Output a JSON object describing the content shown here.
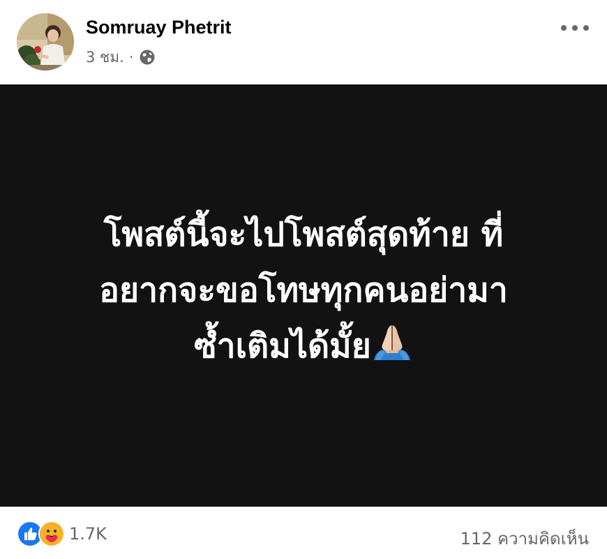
{
  "post": {
    "author_name": "Somruay Phetrit",
    "timestamp": "3 ชม.",
    "meta_separator": "·",
    "privacy_icon": "globe-icon",
    "more_icon": "more-options-icon",
    "image_text_lines": [
      "โพสต์นี้จะไปโพสต์สุดท้าย ที่",
      "อยากจะขอโทษทุกคนอย่ามา",
      "ซ้ำเติมได้มั้ย"
    ],
    "image_emoji": "folded-hands-icon",
    "image_background": "#121212"
  },
  "footer": {
    "reaction_icons": [
      "like-icon",
      "care-icon"
    ],
    "reaction_count": "1.7K",
    "comments": "112 ความคิดเห็น"
  },
  "colors": {
    "like_blue": "#1877f2",
    "care_yellow": "#f7b125",
    "secondary_text": "#65676b"
  }
}
